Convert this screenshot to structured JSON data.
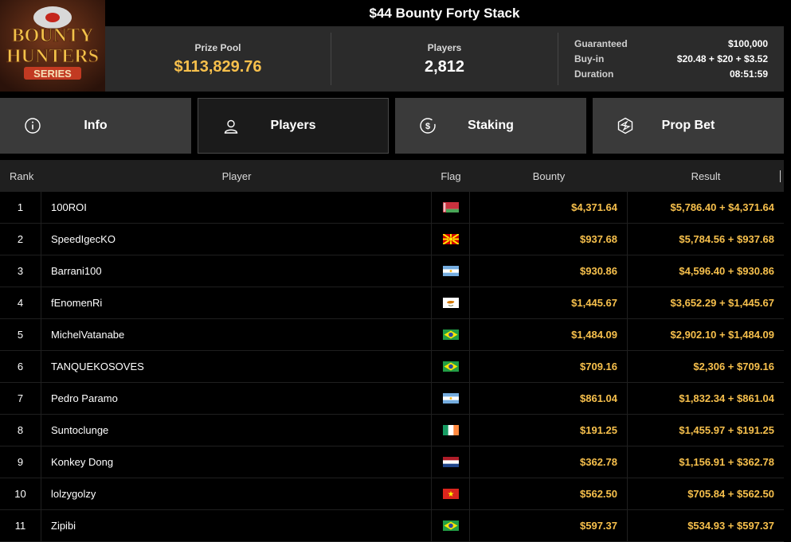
{
  "header": {
    "logo_line1": "BOUNTY",
    "logo_line2": "HUNTERS",
    "logo_line3": "SERIES",
    "title": "$44 Bounty Forty Stack",
    "prize_pool_label": "Prize Pool",
    "prize_pool_value": "$113,829.76",
    "players_label": "Players",
    "players_value": "2,812",
    "guaranteed_label": "Guaranteed",
    "guaranteed_value": "$100,000",
    "buyin_label": "Buy-in",
    "buyin_value": "$20.48 + $20 + $3.52",
    "duration_label": "Duration",
    "duration_value": "08:51:59"
  },
  "tabs": [
    {
      "label": "Info",
      "icon": "info-icon"
    },
    {
      "label": "Players",
      "icon": "user-icon"
    },
    {
      "label": "Staking",
      "icon": "dollar-coin-icon"
    },
    {
      "label": "Prop Bet",
      "icon": "prop-bet-icon"
    }
  ],
  "active_tab": "Players",
  "colors": {
    "accent": "#f7c04c",
    "panel": "#2b2b2b",
    "tab": "#3a3a3a"
  },
  "table": {
    "headers": {
      "rank": "Rank",
      "player": "Player",
      "flag": "Flag",
      "bounty": "Bounty",
      "result": "Result"
    },
    "rows": [
      {
        "rank": "1",
        "player": "100ROI",
        "flag": "belarus",
        "bounty": "$4,371.64",
        "result": "$5,786.40 + $4,371.64"
      },
      {
        "rank": "2",
        "player": "SpeedIgecKO",
        "flag": "north-macedonia",
        "bounty": "$937.68",
        "result": "$5,784.56 + $937.68"
      },
      {
        "rank": "3",
        "player": "Barrani100",
        "flag": "argentina",
        "bounty": "$930.86",
        "result": "$4,596.40 + $930.86"
      },
      {
        "rank": "4",
        "player": "fEnomenRi",
        "flag": "cyprus",
        "bounty": "$1,445.67",
        "result": "$3,652.29 + $1,445.67"
      },
      {
        "rank": "5",
        "player": "MichelVatanabe",
        "flag": "brazil",
        "bounty": "$1,484.09",
        "result": "$2,902.10 + $1,484.09"
      },
      {
        "rank": "6",
        "player": "TANQUEKOSOVES",
        "flag": "brazil",
        "bounty": "$709.16",
        "result": "$2,306 + $709.16"
      },
      {
        "rank": "7",
        "player": "Pedro Paramo",
        "flag": "argentina",
        "bounty": "$861.04",
        "result": "$1,832.34 + $861.04"
      },
      {
        "rank": "8",
        "player": "Suntoclunge",
        "flag": "ireland",
        "bounty": "$191.25",
        "result": "$1,455.97 + $191.25"
      },
      {
        "rank": "9",
        "player": "Konkey Dong",
        "flag": "netherlands",
        "bounty": "$362.78",
        "result": "$1,156.91 + $362.78"
      },
      {
        "rank": "10",
        "player": "lolzygolzy",
        "flag": "vietnam",
        "bounty": "$562.50",
        "result": "$705.84 + $562.50"
      },
      {
        "rank": "11",
        "player": "Zipibi",
        "flag": "brazil",
        "bounty": "$597.37",
        "result": "$534.93 + $597.37"
      }
    ]
  }
}
